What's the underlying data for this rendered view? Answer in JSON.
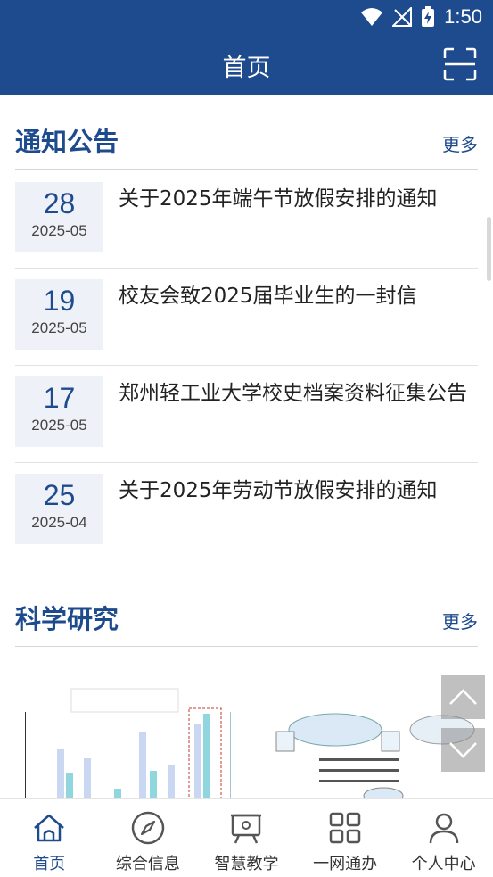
{
  "status": {
    "time": "1:50"
  },
  "appbar": {
    "title": "首页"
  },
  "notices": {
    "title": "通知公告",
    "more": "更多",
    "items": [
      {
        "day": "28",
        "ym": "2025-05",
        "title": "关于2025年端午节放假安排的通知"
      },
      {
        "day": "19",
        "ym": "2025-05",
        "title": "校友会致2025届毕业生的一封信"
      },
      {
        "day": "17",
        "ym": "2025-05",
        "title": "郑州轻工业大学校史档案资料征集公告"
      },
      {
        "day": "25",
        "ym": "2025-04",
        "title": "关于2025年劳动节放假安排的通知"
      }
    ]
  },
  "research": {
    "title": "科学研究",
    "more": "更多"
  },
  "tabs": [
    {
      "label": "首页",
      "icon": "home-icon",
      "active": true
    },
    {
      "label": "综合信息",
      "icon": "compass-icon",
      "active": false
    },
    {
      "label": "智慧教学",
      "icon": "teaching-board-icon",
      "active": false
    },
    {
      "label": "一网通办",
      "icon": "grid-apps-icon",
      "active": false
    },
    {
      "label": "个人中心",
      "icon": "person-icon",
      "active": false
    }
  ],
  "colors": {
    "brand": "#1e4a8e",
    "date_bg": "#eef2f8"
  }
}
